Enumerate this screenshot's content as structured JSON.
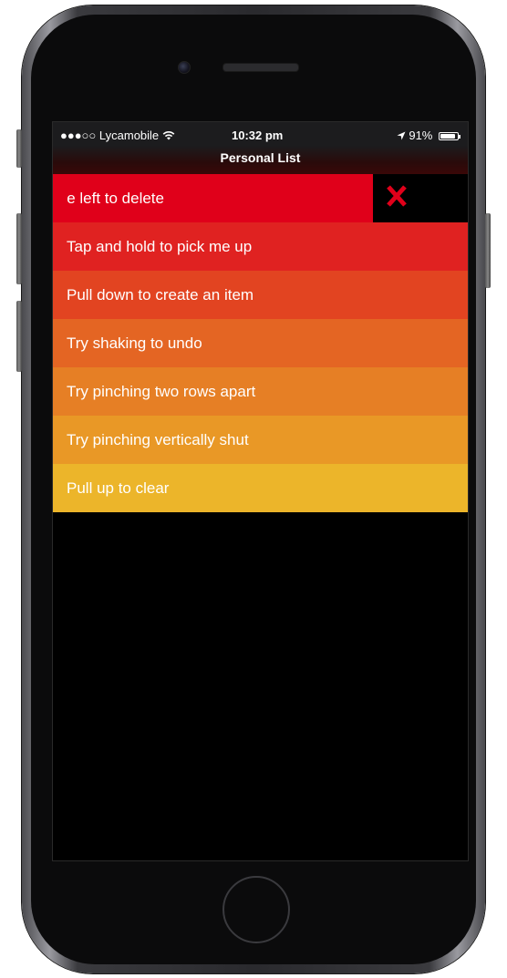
{
  "status_bar": {
    "signal": "●●●○○",
    "carrier": "Lycamobile",
    "wifi_icon": "wifi-icon",
    "time": "10:32 pm",
    "location_icon": "location-arrow-icon",
    "battery_percent": "91%",
    "battery_level": 0.91
  },
  "nav": {
    "title": "Personal List"
  },
  "swiped_item": {
    "visible_text": "e left to delete",
    "color": "#e0001a",
    "delete_icon": "delete-x-icon",
    "delete_color": "#e0001a"
  },
  "items": [
    {
      "label": "Tap and hold to pick me up",
      "color": "#e02221"
    },
    {
      "label": "Pull down to create an item",
      "color": "#e24421"
    },
    {
      "label": "Try shaking to undo",
      "color": "#e46523"
    },
    {
      "label": "Try pinching two rows apart",
      "color": "#e67f25"
    },
    {
      "label": "Try pinching vertically shut",
      "color": "#e99826"
    },
    {
      "label": "Pull up to clear",
      "color": "#ecb52a"
    }
  ]
}
